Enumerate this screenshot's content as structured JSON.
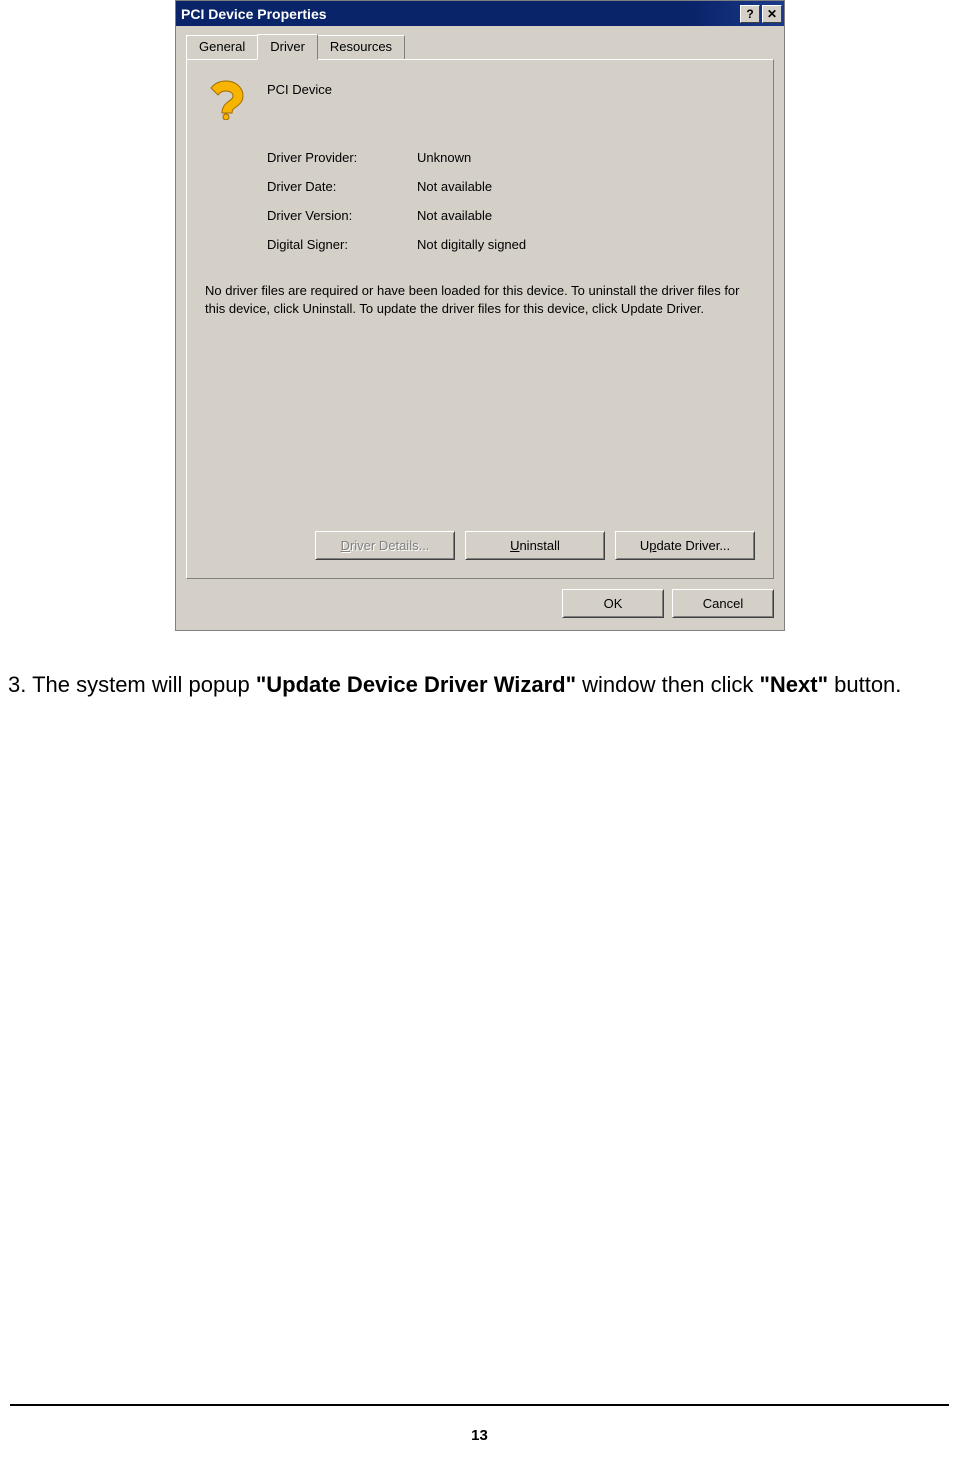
{
  "dialog": {
    "title": "PCI Device Properties",
    "tabs": {
      "general": "General",
      "driver": "Driver",
      "resources": "Resources",
      "active": "driver"
    },
    "device_name": "PCI Device",
    "rows": {
      "provider_label": "Driver Provider:",
      "provider_value": "Unknown",
      "date_label": "Driver Date:",
      "date_value": "Not available",
      "version_label": "Driver Version:",
      "version_value": "Not available",
      "signer_label": "Digital Signer:",
      "signer_value": "Not digitally signed"
    },
    "description": "No driver files are required or have been loaded for this device. To uninstall the driver files for this device, click Uninstall. To update the driver files for this device, click Update Driver.",
    "buttons": {
      "details": "Driver Details...",
      "uninstall": "Uninstall",
      "update": "Update Driver...",
      "ok": "OK",
      "cancel": "Cancel"
    }
  },
  "instruction": {
    "prefix": "3. The system will popup ",
    "bold1": "\"Update Device Driver Wizard\"",
    "middle": " window then click ",
    "bold2": "\"Next\"",
    "suffix": " button."
  },
  "page_number": "13"
}
